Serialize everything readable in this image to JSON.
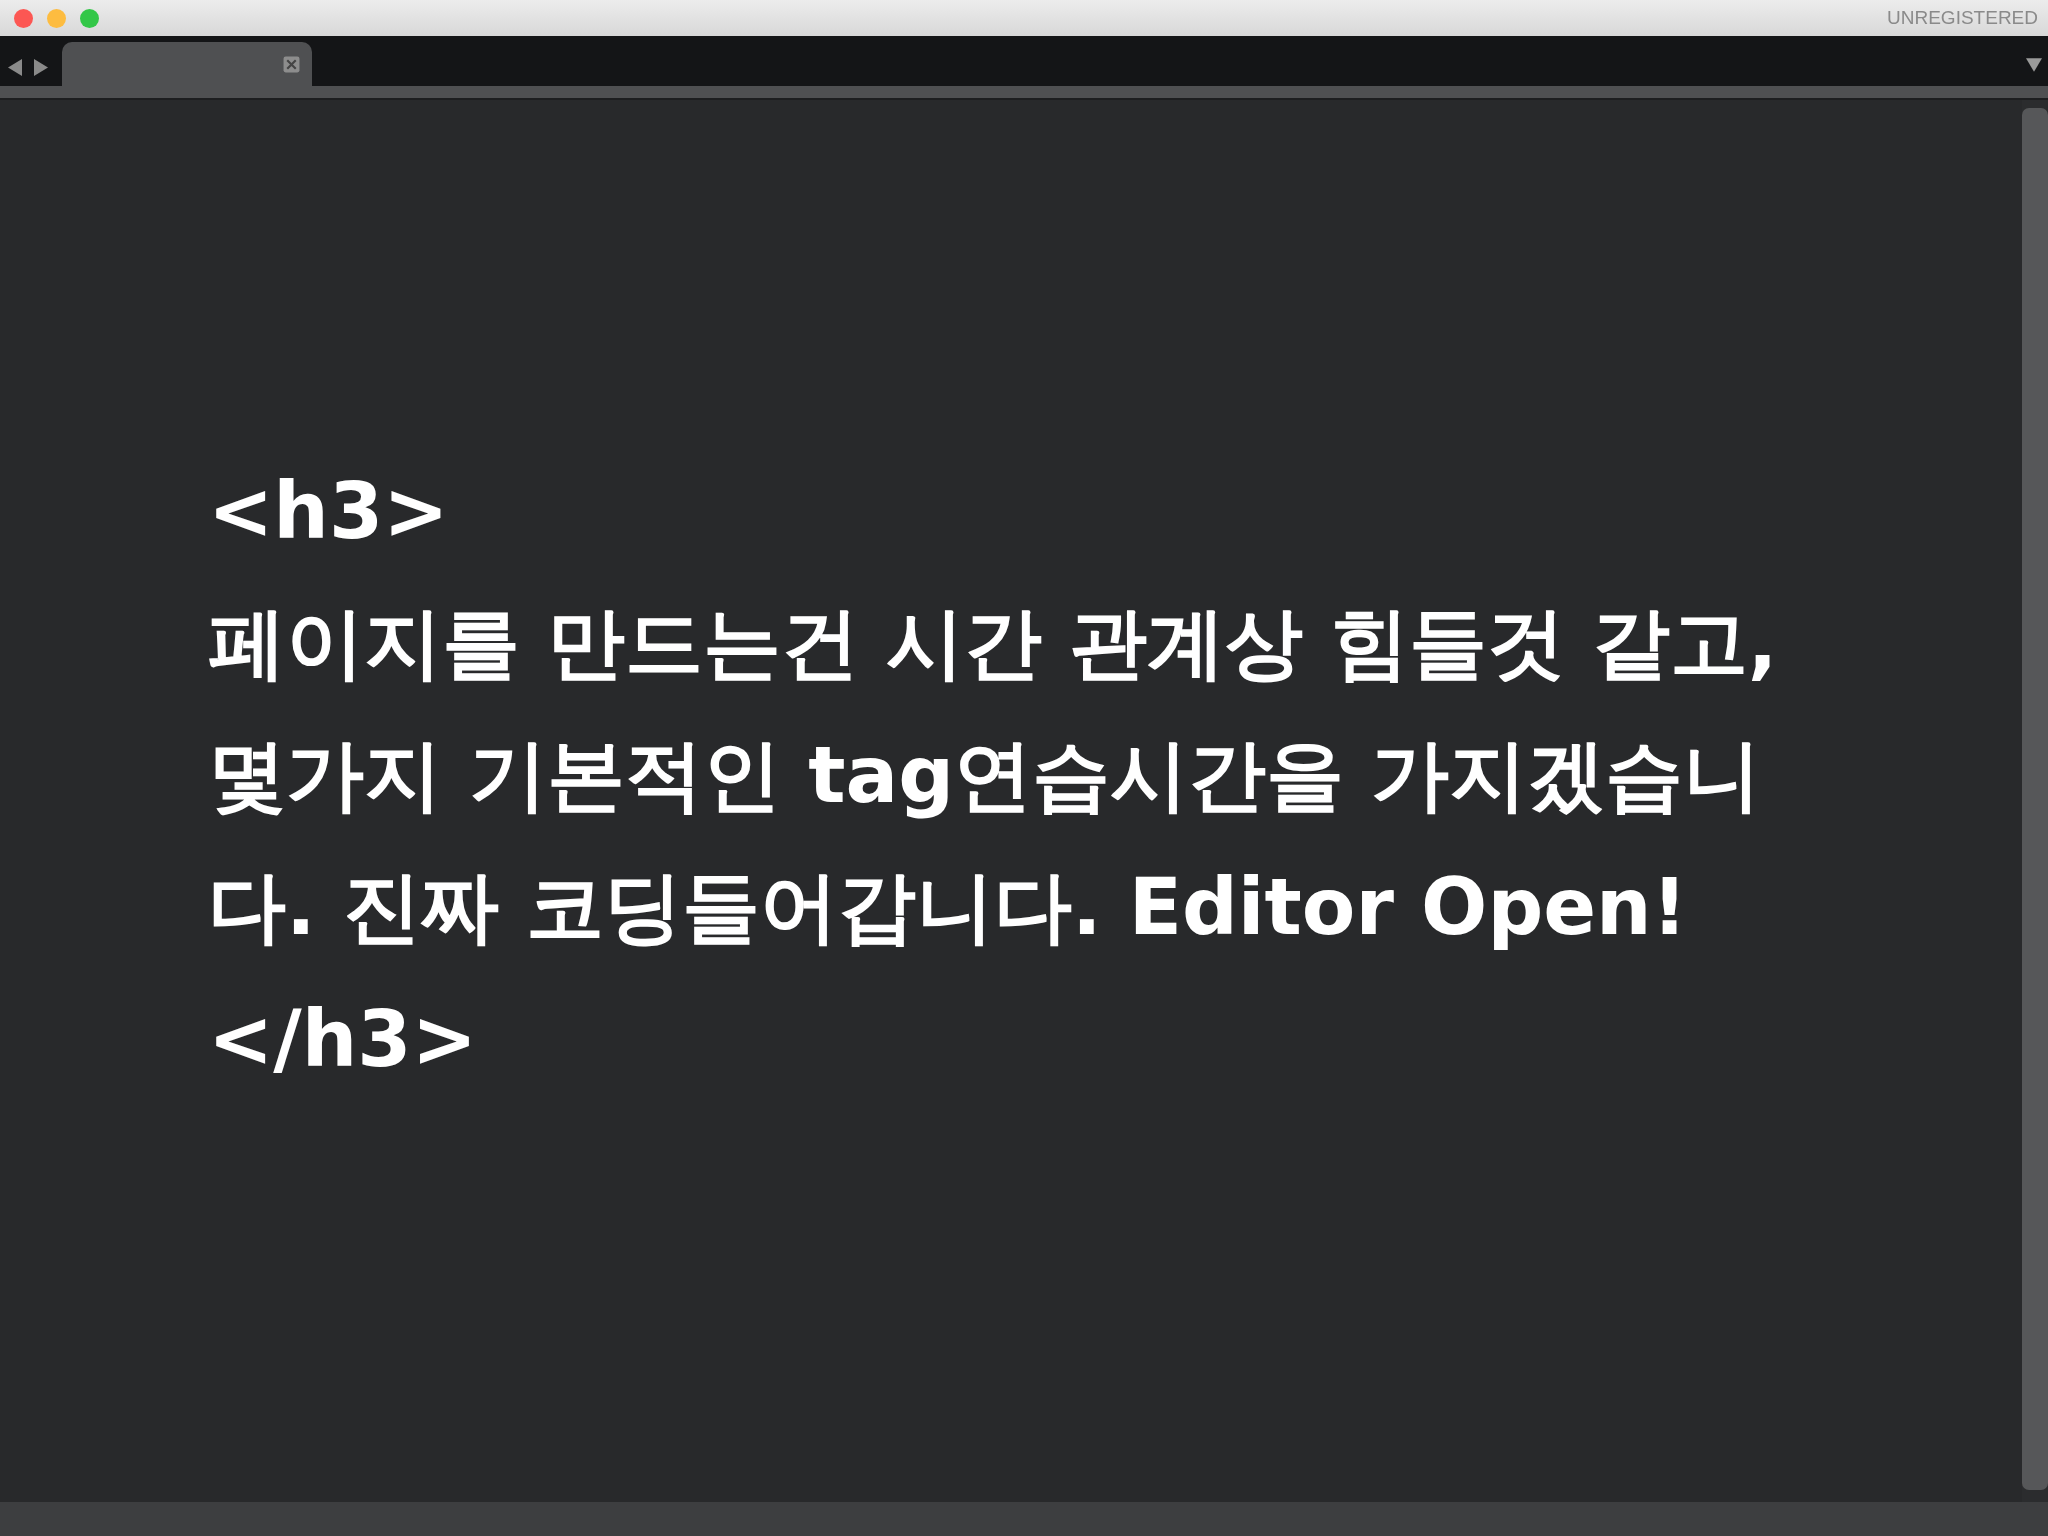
{
  "window": {
    "title": "UNREGISTERED"
  },
  "tabs": [
    {
      "selected": true
    }
  ],
  "editor": {
    "lines": [
      "<h3>",
      "페이지를 만드는건 시간 관계상 힘들것 같고,",
      "몇가지 기본적인 tag연습시간을 가지겠습니",
      "다. 진짜 코딩들어갑니다. Editor Open!",
      "</h3>"
    ]
  }
}
